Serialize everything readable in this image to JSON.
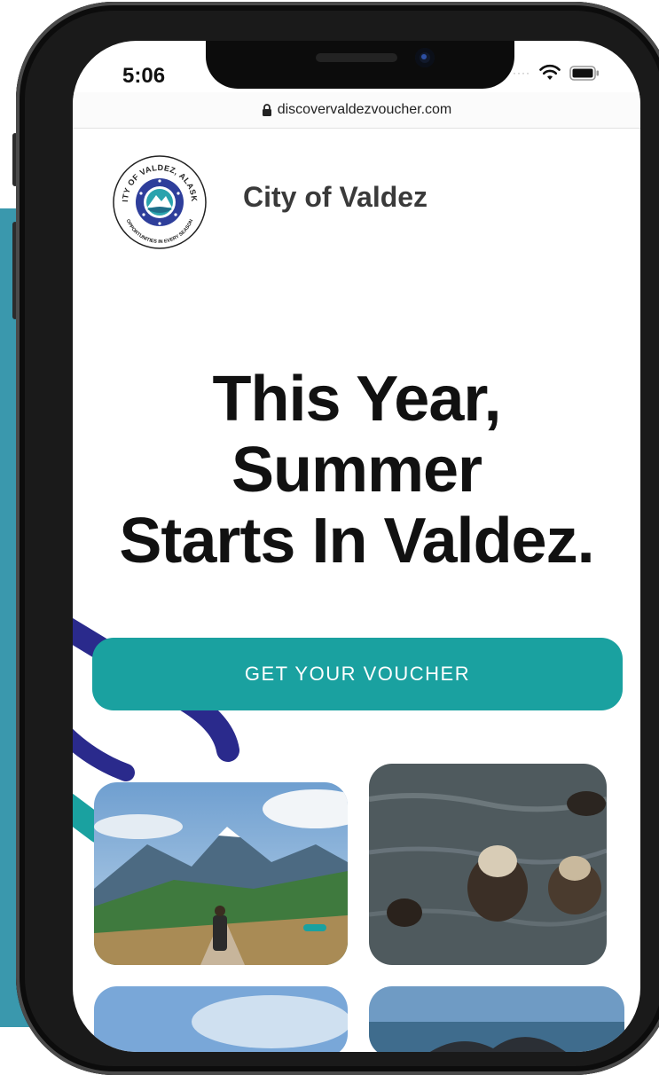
{
  "status_bar": {
    "time": "5:06"
  },
  "browser": {
    "url": "discovervaldezvoucher.com"
  },
  "header": {
    "site_name": "City of Valdez",
    "logo": {
      "top_text": "CITY OF VALDEZ, ALASKA",
      "bottom_text": "OPPORTUNITIES IN EVERY SEASON"
    }
  },
  "hero": {
    "headline_lines": [
      "This Year,",
      "Summer",
      "Starts In Valdez."
    ],
    "cta_label": "GET YOUR VOUCHER"
  },
  "colors": {
    "accent": "#1aa1a0",
    "panel": "#3a98ad",
    "swoosh": "#2a2a8c"
  },
  "icons": [
    "lock-icon",
    "wifi-icon",
    "battery-icon"
  ]
}
